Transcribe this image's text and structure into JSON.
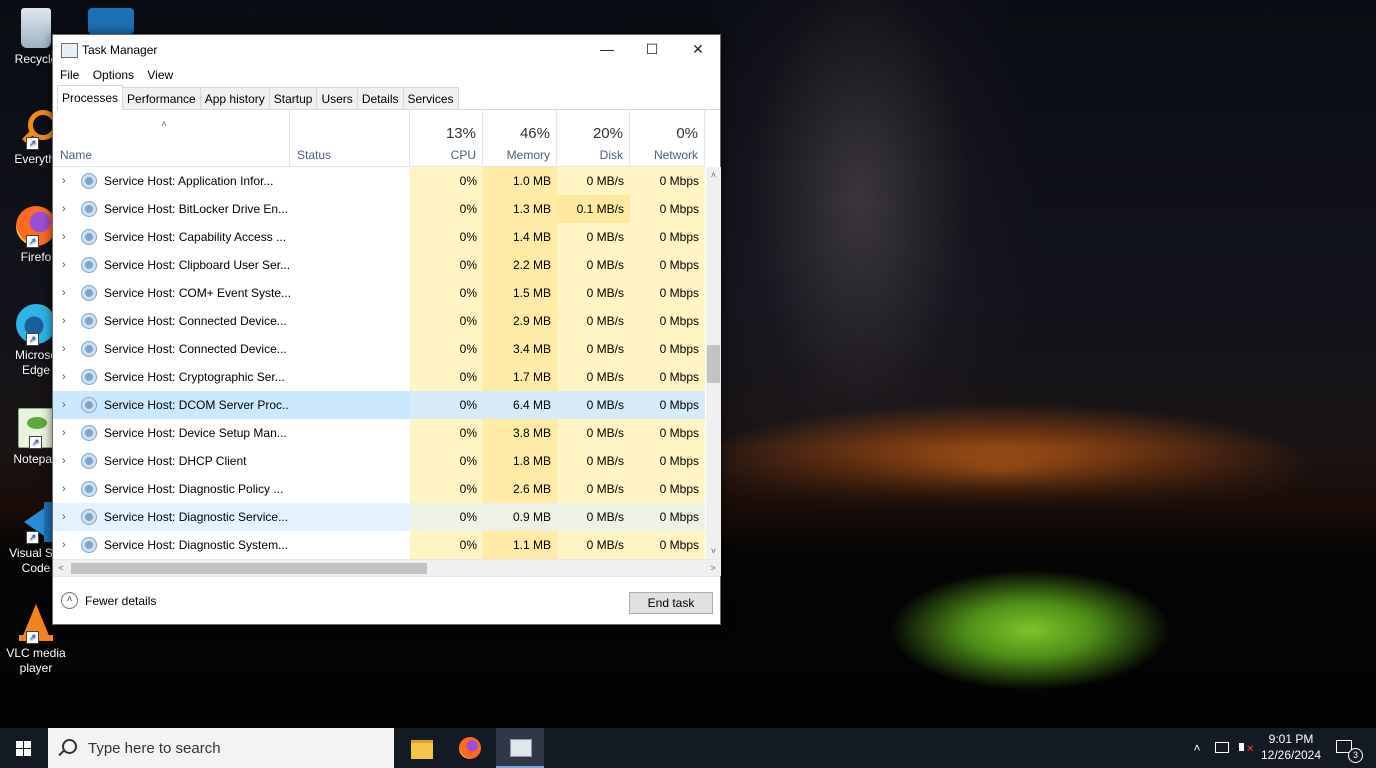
{
  "desktop": {
    "icons": [
      {
        "label": "Recycle",
        "name": "recycle-bin"
      },
      {
        "label": "Everythi",
        "name": "everything"
      },
      {
        "label": "Firefo",
        "name": "firefox"
      },
      {
        "label": "Microso Edge",
        "name": "edge"
      },
      {
        "label": "Notepad",
        "name": "notepad"
      },
      {
        "label": "Visual Stu Code",
        "name": "vscode"
      },
      {
        "label": "VLC media player",
        "name": "vlc"
      }
    ]
  },
  "window": {
    "title": "Task Manager",
    "controls": {
      "minimize": "—",
      "maximize": "☐",
      "close": "✕"
    },
    "menu": [
      "File",
      "Options",
      "View"
    ],
    "tabs": [
      "Processes",
      "Performance",
      "App history",
      "Startup",
      "Users",
      "Details",
      "Services"
    ],
    "active_tab": "Processes"
  },
  "columns": {
    "name": "Name",
    "status": "Status",
    "cpu": {
      "pct": "13%",
      "label": "CPU"
    },
    "memory": {
      "pct": "46%",
      "label": "Memory"
    },
    "disk": {
      "pct": "20%",
      "label": "Disk"
    },
    "network": {
      "pct": "0%",
      "label": "Network"
    }
  },
  "processes": [
    {
      "name": "Service Host: Application Infor...",
      "cpu": "0%",
      "memory": "1.0 MB",
      "disk": "0 MB/s",
      "network": "0 Mbps"
    },
    {
      "name": "Service Host: BitLocker Drive En...",
      "cpu": "0%",
      "memory": "1.3 MB",
      "disk": "0.1 MB/s",
      "network": "0 Mbps"
    },
    {
      "name": "Service Host: Capability Access ...",
      "cpu": "0%",
      "memory": "1.4 MB",
      "disk": "0 MB/s",
      "network": "0 Mbps"
    },
    {
      "name": "Service Host: Clipboard User Ser...",
      "cpu": "0%",
      "memory": "2.2 MB",
      "disk": "0 MB/s",
      "network": "0 Mbps"
    },
    {
      "name": "Service Host: COM+ Event Syste...",
      "cpu": "0%",
      "memory": "1.5 MB",
      "disk": "0 MB/s",
      "network": "0 Mbps"
    },
    {
      "name": "Service Host: Connected Device...",
      "cpu": "0%",
      "memory": "2.9 MB",
      "disk": "0 MB/s",
      "network": "0 Mbps"
    },
    {
      "name": "Service Host: Connected Device...",
      "cpu": "0%",
      "memory": "3.4 MB",
      "disk": "0 MB/s",
      "network": "0 Mbps"
    },
    {
      "name": "Service Host: Cryptographic Ser...",
      "cpu": "0%",
      "memory": "1.7 MB",
      "disk": "0 MB/s",
      "network": "0 Mbps"
    },
    {
      "name": "Service Host: DCOM Server Proc...",
      "cpu": "0%",
      "memory": "6.4 MB",
      "disk": "0 MB/s",
      "network": "0 Mbps",
      "state": "selected"
    },
    {
      "name": "Service Host: Device Setup Man...",
      "cpu": "0%",
      "memory": "3.8 MB",
      "disk": "0 MB/s",
      "network": "0 Mbps"
    },
    {
      "name": "Service Host: DHCP Client",
      "cpu": "0%",
      "memory": "1.8 MB",
      "disk": "0 MB/s",
      "network": "0 Mbps"
    },
    {
      "name": "Service Host: Diagnostic Policy ...",
      "cpu": "0%",
      "memory": "2.6 MB",
      "disk": "0 MB/s",
      "network": "0 Mbps"
    },
    {
      "name": "Service Host: Diagnostic Service...",
      "cpu": "0%",
      "memory": "0.9 MB",
      "disk": "0 MB/s",
      "network": "0 Mbps",
      "state": "hover"
    },
    {
      "name": "Service Host: Diagnostic System...",
      "cpu": "0%",
      "memory": "1.1 MB",
      "disk": "0 MB/s",
      "network": "0 Mbps"
    }
  ],
  "footer": {
    "fewer_details": "Fewer details",
    "end_task": "End task"
  },
  "taskbar": {
    "search_placeholder": "Type here to search",
    "time": "9:01 PM",
    "date": "12/26/2024",
    "notifications": "3"
  },
  "colors": {
    "selected_row": "#cce8ff",
    "heat_light": "#fff4c4",
    "heat_med": "#ffeaa6",
    "taskbar": "#131a24"
  }
}
